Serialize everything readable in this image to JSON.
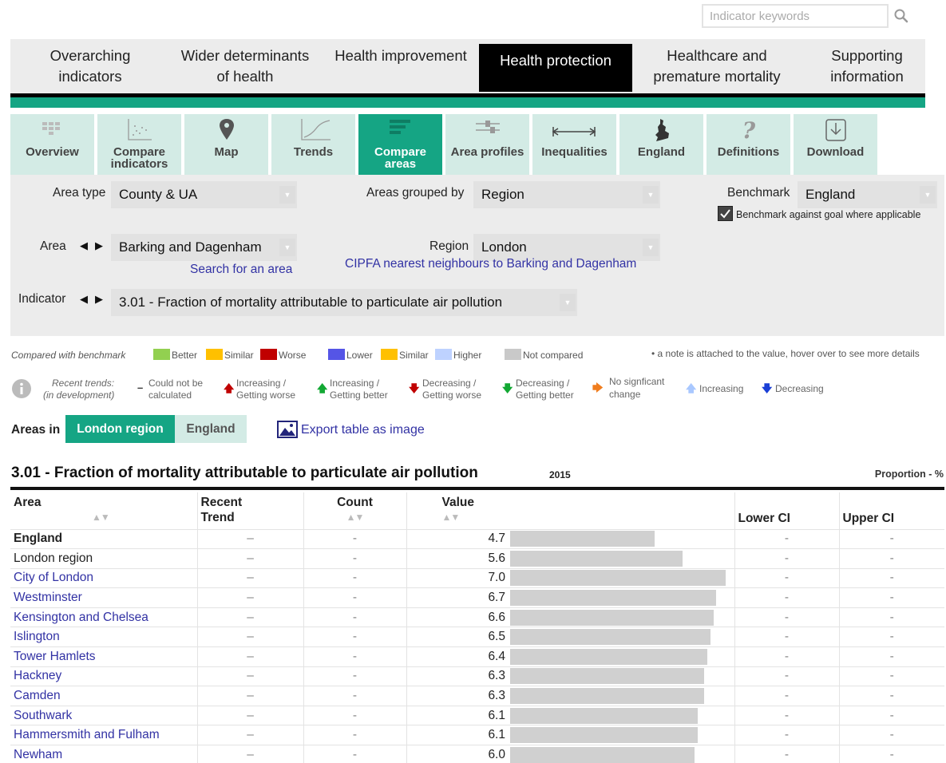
{
  "search": {
    "placeholder": "Indicator keywords"
  },
  "domains": [
    {
      "label": "Overarching indicators",
      "active": false
    },
    {
      "label": "Wider determinants of health",
      "active": false
    },
    {
      "label": "Health improvement",
      "active": false
    },
    {
      "label": "Health protection",
      "active": true
    },
    {
      "label": "Healthcare and premature mortality",
      "active": false
    },
    {
      "label": "Supporting information",
      "active": false
    }
  ],
  "tabs": [
    {
      "label": "Overview",
      "icon": "overview-icon"
    },
    {
      "label": "Compare indicators",
      "icon": "scatter-icon"
    },
    {
      "label": "Map",
      "icon": "map-pin-icon"
    },
    {
      "label": "Trends",
      "icon": "trend-line-icon"
    },
    {
      "label": "Compare areas",
      "icon": "bar-chart-icon",
      "active": true
    },
    {
      "label": "Area profiles",
      "icon": "profile-icon"
    },
    {
      "label": "Inequalities",
      "icon": "range-icon"
    },
    {
      "label": "England",
      "icon": "england-map-icon"
    },
    {
      "label": "Definitions",
      "icon": "question-icon"
    },
    {
      "label": "Download",
      "icon": "download-icon"
    }
  ],
  "filters": {
    "area_type_label": "Area type",
    "area_type_value": "County & UA",
    "grouped_label": "Areas grouped by",
    "grouped_value": "Region",
    "benchmark_label": "Benchmark",
    "benchmark_value": "England",
    "benchmark_goal_label": "Benchmark against goal where applicable",
    "area_label": "Area",
    "area_value": "Barking and Dagenham",
    "search_area_link": "Search for an area",
    "region_label": "Region",
    "region_value": "London",
    "cipfa_link": "CIPFA nearest neighbours to Barking and Dagenham",
    "indicator_label": "Indicator",
    "indicator_value": "3.01 - Fraction of mortality attributable to particulate air pollution"
  },
  "legend": {
    "compared_label": "Compared with benchmark",
    "better": "Better",
    "similar": "Similar",
    "worse": "Worse",
    "lower": "Lower",
    "similar2": "Similar",
    "higher": "Higher",
    "not_compared": "Not compared",
    "note": "• a note is attached to the value, hover over to see more details",
    "colors": {
      "better": "#92d050",
      "similar": "#ffc000",
      "worse": "#c00000",
      "lower": "#5555e6",
      "higher": "#bed2ff",
      "not_compared": "#c9c9c9"
    },
    "trends_label_1": "Recent trends:",
    "trends_label_2": "(in development)",
    "could_not_1": "Could not be",
    "could_not_2": "calculated",
    "inc_worse_1": "Increasing /",
    "inc_worse_2": "Getting worse",
    "inc_better_1": "Increasing /",
    "inc_better_2": "Getting better",
    "dec_worse_1": "Decreasing /",
    "dec_worse_2": "Getting worse",
    "dec_better_1": "Decreasing /",
    "dec_better_2": "Getting better",
    "no_sig_1": "No signficant",
    "no_sig_2": "change",
    "increasing": "Increasing",
    "decreasing": "Decreasing"
  },
  "areas_in": {
    "label": "Areas in",
    "london_btn": "London region",
    "england_btn": "England",
    "export_label": "Export table as image"
  },
  "table": {
    "title": "3.01 - Fraction of mortality attributable to particulate air pollution",
    "year": "2015",
    "unit": "Proportion - %",
    "headers": {
      "area": "Area",
      "trend_1": "Recent",
      "trend_2": "Trend",
      "count": "Count",
      "value": "Value",
      "lci": "Lower CI",
      "uci": "Upper CI"
    },
    "bar_max": 7.0,
    "rows": [
      {
        "area": "England",
        "trend": "–",
        "count": "-",
        "value": "4.7",
        "lci": "-",
        "uci": "-",
        "style": "bold"
      },
      {
        "area": "London region",
        "trend": "–",
        "count": "-",
        "value": "5.6",
        "lci": "-",
        "uci": "-",
        "style": "plain"
      },
      {
        "area": "City of London",
        "trend": "–",
        "count": "-",
        "value": "7.0",
        "lci": "-",
        "uci": "-",
        "style": "link"
      },
      {
        "area": "Westminster",
        "trend": "–",
        "count": "-",
        "value": "6.7",
        "lci": "-",
        "uci": "-",
        "style": "link"
      },
      {
        "area": "Kensington and Chelsea",
        "trend": "–",
        "count": "-",
        "value": "6.6",
        "lci": "-",
        "uci": "-",
        "style": "link"
      },
      {
        "area": "Islington",
        "trend": "–",
        "count": "-",
        "value": "6.5",
        "lci": "-",
        "uci": "-",
        "style": "link"
      },
      {
        "area": "Tower Hamlets",
        "trend": "–",
        "count": "-",
        "value": "6.4",
        "lci": "-",
        "uci": "-",
        "style": "link"
      },
      {
        "area": "Hackney",
        "trend": "–",
        "count": "-",
        "value": "6.3",
        "lci": "-",
        "uci": "-",
        "style": "link"
      },
      {
        "area": "Camden",
        "trend": "–",
        "count": "-",
        "value": "6.3",
        "lci": "-",
        "uci": "-",
        "style": "link"
      },
      {
        "area": "Southwark",
        "trend": "–",
        "count": "-",
        "value": "6.1",
        "lci": "-",
        "uci": "-",
        "style": "link"
      },
      {
        "area": "Hammersmith and Fulham",
        "trend": "–",
        "count": "-",
        "value": "6.1",
        "lci": "-",
        "uci": "-",
        "style": "link"
      },
      {
        "area": "Newham",
        "trend": "–",
        "count": "-",
        "value": "6.0",
        "lci": "-",
        "uci": "-",
        "style": "link"
      }
    ]
  }
}
